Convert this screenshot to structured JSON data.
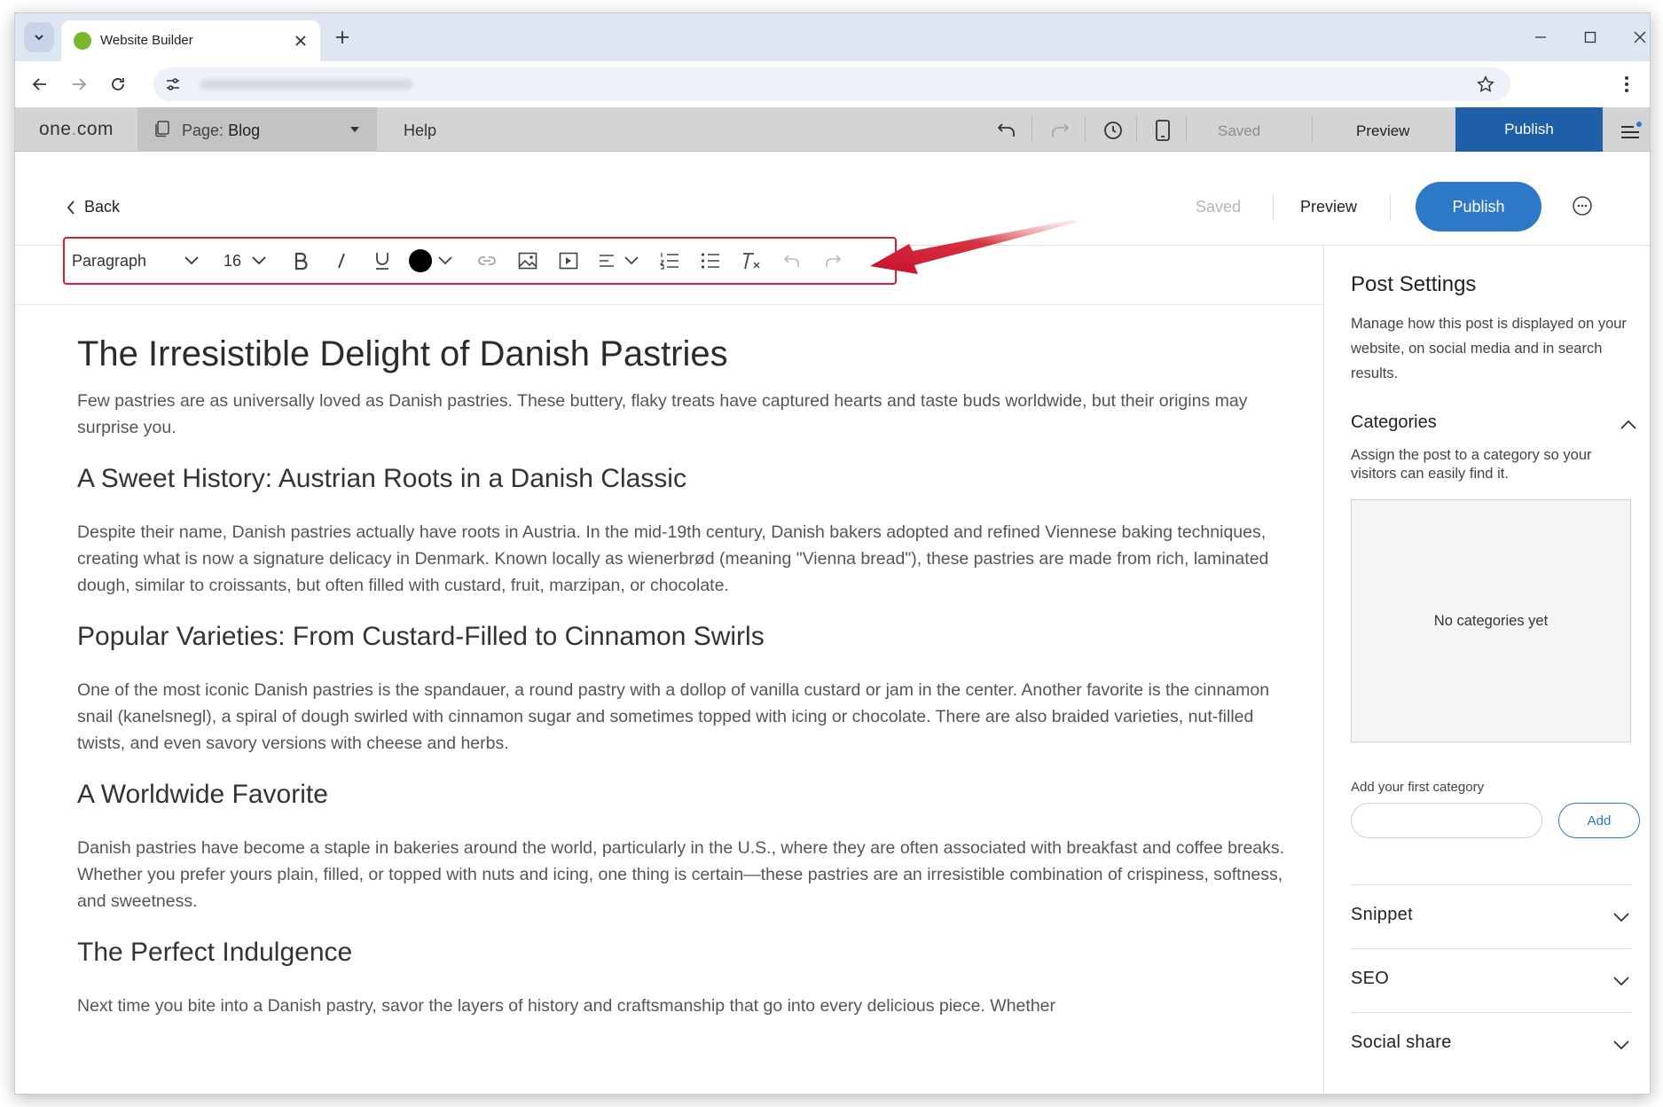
{
  "browser": {
    "tab_title": "Website Builder",
    "accent": "#76b82a"
  },
  "appbar": {
    "logo_main": "one",
    "logo_dot": ".",
    "logo_tld": "com",
    "page_prefix": "Page:",
    "page_name": "Blog",
    "help": "Help",
    "saved": "Saved",
    "preview": "Preview",
    "publish": "Publish"
  },
  "header": {
    "back": "Back",
    "saved": "Saved",
    "preview": "Preview",
    "publish": "Publish",
    "publish_color": "#2d79c8"
  },
  "toolbar": {
    "block_style": "Paragraph",
    "font_size": "16",
    "text_color": "#000000",
    "highlight_color": "#d81e2b",
    "icons": [
      "chevron-down-icon",
      "bold-icon",
      "italic-icon",
      "underline-icon",
      "color-swatch",
      "link-icon",
      "image-icon",
      "video-icon",
      "align-icon",
      "numbered-list-icon",
      "bullet-list-icon",
      "clear-format-icon",
      "undo-icon",
      "redo-icon"
    ]
  },
  "article": {
    "title": "The Irresistible Delight of Danish Pastries",
    "intro": "Few pastries are as universally loved as Danish pastries. These buttery, flaky treats have captured hearts and taste buds worldwide, but their origins may surprise you.",
    "sections": [
      {
        "heading": "A Sweet History: Austrian Roots in a Danish Classic",
        "body": "Despite their name, Danish pastries actually have roots in Austria. In the mid-19th century, Danish bakers adopted and refined Viennese baking techniques, creating what is now a signature delicacy in Denmark. Known locally as wienerbrød (meaning \"Vienna bread\"), these pastries are made from rich, laminated dough, similar to croissants, but often filled with custard, fruit, marzipan, or chocolate."
      },
      {
        "heading": "Popular Varieties: From Custard-Filled to Cinnamon Swirls",
        "body": "One of the most iconic Danish pastries is the spandauer, a round pastry with a dollop of vanilla custard or jam in the center. Another favorite is the cinnamon snail (kanelsnegl), a spiral of dough swirled with cinnamon sugar and sometimes topped with icing or chocolate. There are also braided varieties, nut-filled twists, and even savory versions with cheese and herbs."
      },
      {
        "heading": "A Worldwide Favorite",
        "body": "Danish pastries have become a staple in bakeries around the world, particularly in the U.S., where they are often associated with breakfast and coffee breaks. Whether you prefer yours plain, filled, or topped with nuts and icing, one thing is certain—these pastries are an irresistible combination of crispiness, softness, and sweetness."
      },
      {
        "heading": "The Perfect Indulgence",
        "body": "Next time you bite into a Danish pastry, savor the layers of history and craftsmanship that go into every delicious piece. Whether"
      }
    ]
  },
  "sidebar": {
    "title": "Post Settings",
    "description": "Manage how this post is displayed on your website, on social media and in search results.",
    "categories": {
      "title": "Categories",
      "description": "Assign the post to a category so your visitors can easily find it.",
      "empty": "No categories yet",
      "add_label": "Add your first category",
      "add_input_value": "",
      "add_button": "Add"
    },
    "sections": [
      "Snippet",
      "SEO",
      "Social share"
    ]
  }
}
